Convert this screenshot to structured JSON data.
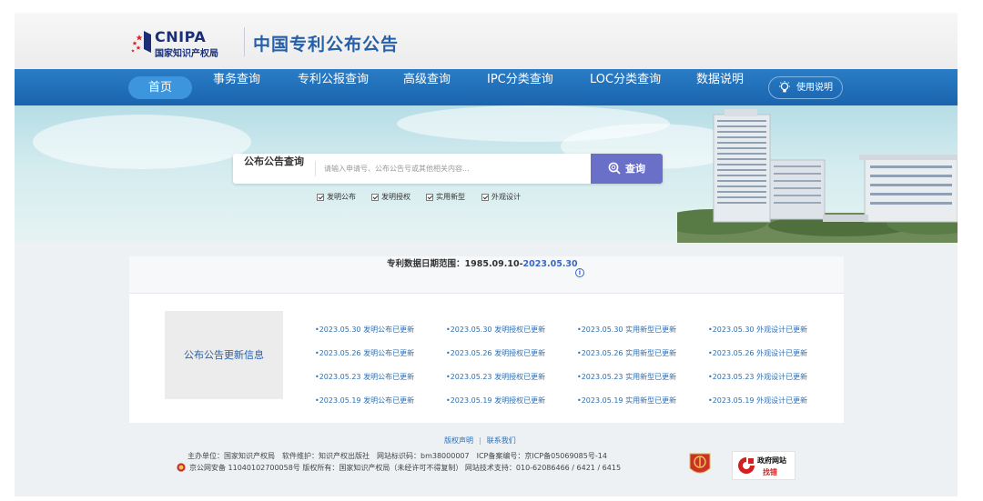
{
  "header": {
    "logo_en": "CNIPA",
    "logo_zh": "国家知识产权局",
    "site_title": "中国专利公布公告"
  },
  "nav": {
    "home": "首页",
    "items": [
      "事务查询",
      "专利公报查询",
      "高级查询",
      "IPC分类查询",
      "LOC分类查询",
      "数据说明"
    ],
    "help": "使用说明"
  },
  "search": {
    "label": "公布公告查询",
    "placeholder": "请输入申请号、公布公告号或其他相关内容...",
    "button": "查询",
    "checkboxes": [
      {
        "label": "发明公布",
        "checked": true
      },
      {
        "label": "发明授权",
        "checked": true
      },
      {
        "label": "实用新型",
        "checked": true
      },
      {
        "label": "外观设计",
        "checked": true
      }
    ]
  },
  "date_range": {
    "prefix": "专利数据日期范围：1985.09.10-",
    "end": "2023.05.30",
    "info_icon": "i"
  },
  "updates": {
    "label": "公布公告更新信息",
    "columns": [
      [
        "•2023.05.30 发明公布已更新",
        "•2023.05.26 发明公布已更新",
        "•2023.05.23 发明公布已更新",
        "•2023.05.19 发明公布已更新"
      ],
      [
        "•2023.05.30 发明授权已更新",
        "•2023.05.26 发明授权已更新",
        "•2023.05.23 发明授权已更新",
        "•2023.05.19 发明授权已更新"
      ],
      [
        "•2023.05.30 实用新型已更新",
        "•2023.05.26 实用新型已更新",
        "•2023.05.23 实用新型已更新",
        "•2023.05.19 实用新型已更新"
      ],
      [
        "•2023.05.30 外观设计已更新",
        "•2023.05.26 外观设计已更新",
        "•2023.05.23 外观设计已更新",
        "•2023.05.19 外观设计已更新"
      ]
    ]
  },
  "footer": {
    "link_copyright": "版权声明",
    "link_contact": "联系我们",
    "line1": "主办单位：国家知识产权局　软件维护：知识产权出版社　网站标识码：bm38000007　ICP备案编号：京ICP备05069085号-14",
    "line2": "京公网安备 11040102700058号  版权所有：国家知识产权局（未经许可不得复制）  网站技术支持：010-62086466 / 6421 / 6415",
    "gov_badge_title": "政府网站",
    "gov_badge_action": "找错"
  },
  "colors": {
    "nav_bg": "#1a64ad",
    "accent": "#6a70c7",
    "link": "#2a6fb8",
    "title": "#2660a8"
  }
}
